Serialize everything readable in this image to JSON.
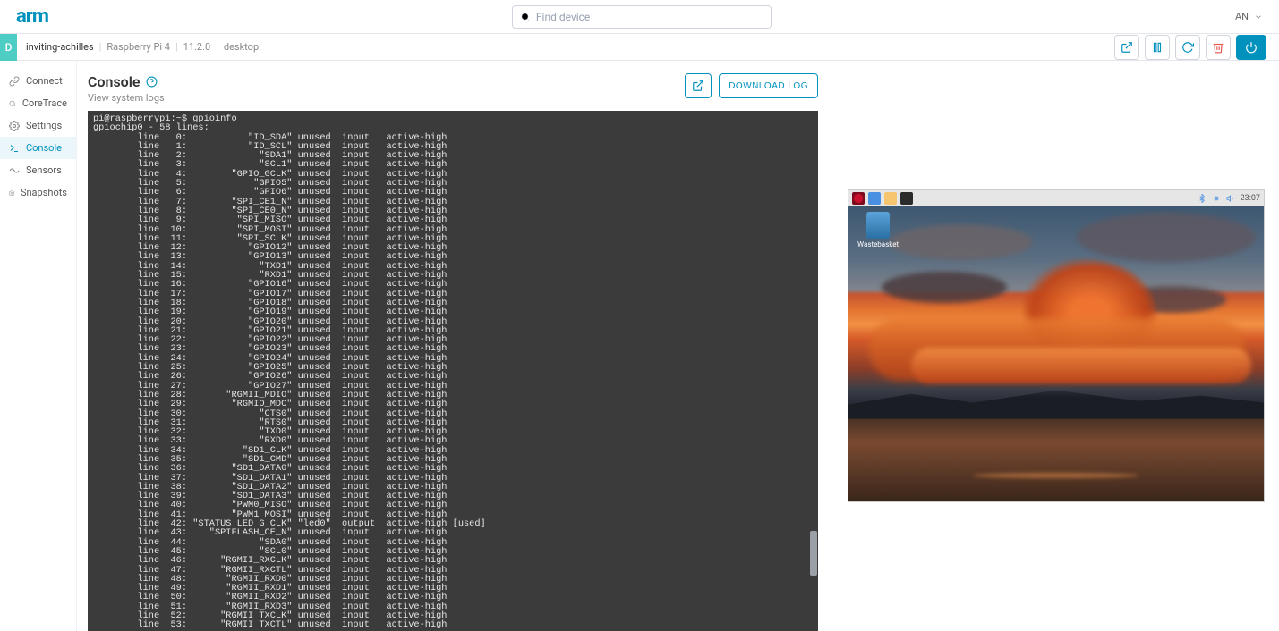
{
  "header": {
    "logo": "arm",
    "search_placeholder": "Find device",
    "user_initials": "AN"
  },
  "breadcrumb": {
    "device_badge": "D",
    "device_name": "inviting-achilles",
    "model": "Raspberry Pi 4",
    "version": "11.2.0",
    "mode": "desktop"
  },
  "sidebar": {
    "items": [
      {
        "label": "Connect"
      },
      {
        "label": "CoreTrace"
      },
      {
        "label": "Settings"
      },
      {
        "label": "Console"
      },
      {
        "label": "Sensors"
      },
      {
        "label": "Snapshots"
      }
    ],
    "active_index": 3
  },
  "console": {
    "title": "Console",
    "subtitle": "View system logs",
    "download_label": "DOWNLOAD LOG",
    "prompt": "pi@raspberrypi:~$ gpioinfo",
    "header_line": "gpiochip0 - 58 lines:",
    "lines": [
      {
        "n": 0,
        "name": "ID_SDA",
        "cons": "unused",
        "dir": "input",
        "al": "active-high"
      },
      {
        "n": 1,
        "name": "ID_SCL",
        "cons": "unused",
        "dir": "input",
        "al": "active-high"
      },
      {
        "n": 2,
        "name": "SDA1",
        "cons": "unused",
        "dir": "input",
        "al": "active-high"
      },
      {
        "n": 3,
        "name": "SCL1",
        "cons": "unused",
        "dir": "input",
        "al": "active-high"
      },
      {
        "n": 4,
        "name": "GPIO_GCLK",
        "cons": "unused",
        "dir": "input",
        "al": "active-high"
      },
      {
        "n": 5,
        "name": "GPIO5",
        "cons": "unused",
        "dir": "input",
        "al": "active-high"
      },
      {
        "n": 6,
        "name": "GPIO6",
        "cons": "unused",
        "dir": "input",
        "al": "active-high"
      },
      {
        "n": 7,
        "name": "SPI_CE1_N",
        "cons": "unused",
        "dir": "input",
        "al": "active-high"
      },
      {
        "n": 8,
        "name": "SPI_CE0_N",
        "cons": "unused",
        "dir": "input",
        "al": "active-high"
      },
      {
        "n": 9,
        "name": "SPI_MISO",
        "cons": "unused",
        "dir": "input",
        "al": "active-high"
      },
      {
        "n": 10,
        "name": "SPI_MOSI",
        "cons": "unused",
        "dir": "input",
        "al": "active-high"
      },
      {
        "n": 11,
        "name": "SPI_SCLK",
        "cons": "unused",
        "dir": "input",
        "al": "active-high"
      },
      {
        "n": 12,
        "name": "GPIO12",
        "cons": "unused",
        "dir": "input",
        "al": "active-high"
      },
      {
        "n": 13,
        "name": "GPIO13",
        "cons": "unused",
        "dir": "input",
        "al": "active-high"
      },
      {
        "n": 14,
        "name": "TXD1",
        "cons": "unused",
        "dir": "input",
        "al": "active-high"
      },
      {
        "n": 15,
        "name": "RXD1",
        "cons": "unused",
        "dir": "input",
        "al": "active-high"
      },
      {
        "n": 16,
        "name": "GPIO16",
        "cons": "unused",
        "dir": "input",
        "al": "active-high"
      },
      {
        "n": 17,
        "name": "GPIO17",
        "cons": "unused",
        "dir": "input",
        "al": "active-high"
      },
      {
        "n": 18,
        "name": "GPIO18",
        "cons": "unused",
        "dir": "input",
        "al": "active-high"
      },
      {
        "n": 19,
        "name": "GPIO19",
        "cons": "unused",
        "dir": "input",
        "al": "active-high"
      },
      {
        "n": 20,
        "name": "GPIO20",
        "cons": "unused",
        "dir": "input",
        "al": "active-high"
      },
      {
        "n": 21,
        "name": "GPIO21",
        "cons": "unused",
        "dir": "input",
        "al": "active-high"
      },
      {
        "n": 22,
        "name": "GPIO22",
        "cons": "unused",
        "dir": "input",
        "al": "active-high"
      },
      {
        "n": 23,
        "name": "GPIO23",
        "cons": "unused",
        "dir": "input",
        "al": "active-high"
      },
      {
        "n": 24,
        "name": "GPIO24",
        "cons": "unused",
        "dir": "input",
        "al": "active-high"
      },
      {
        "n": 25,
        "name": "GPIO25",
        "cons": "unused",
        "dir": "input",
        "al": "active-high"
      },
      {
        "n": 26,
        "name": "GPIO26",
        "cons": "unused",
        "dir": "input",
        "al": "active-high"
      },
      {
        "n": 27,
        "name": "GPIO27",
        "cons": "unused",
        "dir": "input",
        "al": "active-high"
      },
      {
        "n": 28,
        "name": "RGMII_MDIO",
        "cons": "unused",
        "dir": "input",
        "al": "active-high"
      },
      {
        "n": 29,
        "name": "RGMIO_MDC",
        "cons": "unused",
        "dir": "input",
        "al": "active-high"
      },
      {
        "n": 30,
        "name": "CTS0",
        "cons": "unused",
        "dir": "input",
        "al": "active-high"
      },
      {
        "n": 31,
        "name": "RTS0",
        "cons": "unused",
        "dir": "input",
        "al": "active-high"
      },
      {
        "n": 32,
        "name": "TXD0",
        "cons": "unused",
        "dir": "input",
        "al": "active-high"
      },
      {
        "n": 33,
        "name": "RXD0",
        "cons": "unused",
        "dir": "input",
        "al": "active-high"
      },
      {
        "n": 34,
        "name": "SD1_CLK",
        "cons": "unused",
        "dir": "input",
        "al": "active-high"
      },
      {
        "n": 35,
        "name": "SD1_CMD",
        "cons": "unused",
        "dir": "input",
        "al": "active-high"
      },
      {
        "n": 36,
        "name": "SD1_DATA0",
        "cons": "unused",
        "dir": "input",
        "al": "active-high"
      },
      {
        "n": 37,
        "name": "SD1_DATA1",
        "cons": "unused",
        "dir": "input",
        "al": "active-high"
      },
      {
        "n": 38,
        "name": "SD1_DATA2",
        "cons": "unused",
        "dir": "input",
        "al": "active-high"
      },
      {
        "n": 39,
        "name": "SD1_DATA3",
        "cons": "unused",
        "dir": "input",
        "al": "active-high"
      },
      {
        "n": 40,
        "name": "PWM0_MISO",
        "cons": "unused",
        "dir": "input",
        "al": "active-high"
      },
      {
        "n": 41,
        "name": "PWM1_MOSI",
        "cons": "unused",
        "dir": "input",
        "al": "active-high"
      },
      {
        "n": 42,
        "name": "STATUS_LED_G_CLK",
        "cons": "\"led0\"",
        "dir": "output",
        "al": "active-high",
        "extra": "[used]"
      },
      {
        "n": 43,
        "name": "SPIFLASH_CE_N",
        "cons": "unused",
        "dir": "input",
        "al": "active-high"
      },
      {
        "n": 44,
        "name": "SDA0",
        "cons": "unused",
        "dir": "input",
        "al": "active-high"
      },
      {
        "n": 45,
        "name": "SCL0",
        "cons": "unused",
        "dir": "input",
        "al": "active-high"
      },
      {
        "n": 46,
        "name": "RGMII_RXCLK",
        "cons": "unused",
        "dir": "input",
        "al": "active-high"
      },
      {
        "n": 47,
        "name": "RGMII_RXCTL",
        "cons": "unused",
        "dir": "input",
        "al": "active-high"
      },
      {
        "n": 48,
        "name": "RGMII_RXD0",
        "cons": "unused",
        "dir": "input",
        "al": "active-high"
      },
      {
        "n": 49,
        "name": "RGMII_RXD1",
        "cons": "unused",
        "dir": "input",
        "al": "active-high"
      },
      {
        "n": 50,
        "name": "RGMII_RXD2",
        "cons": "unused",
        "dir": "input",
        "al": "active-high"
      },
      {
        "n": 51,
        "name": "RGMII_RXD3",
        "cons": "unused",
        "dir": "input",
        "al": "active-high"
      },
      {
        "n": 52,
        "name": "RGMII_TXCLK",
        "cons": "unused",
        "dir": "input",
        "al": "active-high"
      },
      {
        "n": 53,
        "name": "RGMII_TXCTL",
        "cons": "unused",
        "dir": "input",
        "al": "active-high"
      }
    ]
  },
  "vnc": {
    "clock": "23:07",
    "wastebasket_label": "Wastebasket"
  }
}
